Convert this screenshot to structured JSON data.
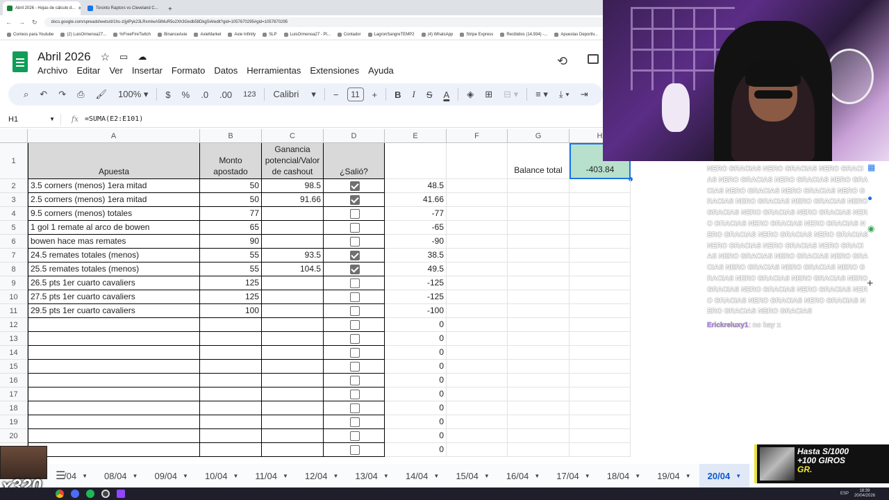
{
  "browser": {
    "tabs": [
      {
        "label": "Abril 2026 - Hojas de cálculo d...",
        "active": true
      },
      {
        "label": "Toronto Raptors vs Cleveland C...",
        "active": false
      }
    ],
    "new_tab": "+",
    "url": "docs.google.com/spreadsheets/d/1hs-zIjylPyk23LRxmIwA5lMuR5o2Xh3Gedb58DkgSi4/edit?gid=1057670295#gid=1057670295",
    "bookmarks": [
      "Correos para Youtube",
      "(2) LuisOrmenoa27...",
      "%FreeFireTwitch",
      "BinanceAxie",
      "AxieMarket",
      "Axie Infinity",
      "SLP",
      "LuisOrmenoa27 - Pl...",
      "Contador",
      "LagronSangreTEMP2",
      "(4) WhatsApp",
      "Stripe Express",
      "Recibidos (14,934) -...",
      "Apuestas Deportiv..."
    ]
  },
  "sheets": {
    "doc_title": "Abril 2026",
    "menu": [
      "Archivo",
      "Editar",
      "Ver",
      "Insertar",
      "Formato",
      "Datos",
      "Herramientas",
      "Extensiones",
      "Ayuda"
    ],
    "toolbar": {
      "zoom": "100%",
      "currency": "$",
      "percent": "%",
      "dec_less": ".0",
      "dec_more": ".00",
      "format_num": "123",
      "font": "Calibri",
      "font_size": "11",
      "minus": "−",
      "plus": "+",
      "bold": "B",
      "italic": "I",
      "strike": "S",
      "text_color": "A"
    },
    "name_box": "H1",
    "fx_label": "fx",
    "formula": "=SUMA(E2:E101)",
    "columns": [
      "A",
      "B",
      "C",
      "D",
      "E",
      "F",
      "G",
      "H"
    ],
    "header_row": {
      "a": "Apuesta",
      "b": "Monto apostado",
      "c": "Ganancia potencial/Valor de cashout",
      "d": "¿Salió?",
      "g": "Balance total",
      "h": "-403.84"
    },
    "rows": [
      {
        "n": "2",
        "a": "3.5 corners (menos) 1era mitad",
        "b": "50",
        "c": "98.5",
        "checked": true,
        "e": "48.5"
      },
      {
        "n": "3",
        "a": "2.5 corners (menos) 1era mitad",
        "b": "50",
        "c": "91.66",
        "checked": true,
        "e": "41.66"
      },
      {
        "n": "4",
        "a": "9.5 corners (menos) totales",
        "b": "77",
        "c": "",
        "checked": false,
        "e": "-77"
      },
      {
        "n": "5",
        "a": "1 gol 1 remate al arco de bowen",
        "b": "65",
        "c": "",
        "checked": false,
        "e": "-65"
      },
      {
        "n": "6",
        "a": "bowen hace mas remates",
        "b": "90",
        "c": "",
        "checked": false,
        "e": "-90"
      },
      {
        "n": "7",
        "a": "24.5 remates totales (menos)",
        "b": "55",
        "c": "93.5",
        "checked": true,
        "e": "38.5"
      },
      {
        "n": "8",
        "a": "25.5 remates totales (menos)",
        "b": "55",
        "c": "104.5",
        "checked": true,
        "e": "49.5"
      },
      {
        "n": "9",
        "a": "26.5 pts 1er cuarto cavaliers",
        "b": "125",
        "c": "",
        "checked": false,
        "e": "-125"
      },
      {
        "n": "10",
        "a": "27.5 pts 1er cuarto cavaliers",
        "b": "125",
        "c": "",
        "checked": false,
        "e": "-125"
      },
      {
        "n": "11",
        "a": "29.5 pts 1er cuarto cavaliers",
        "b": "100",
        "c": "",
        "checked": false,
        "e": "-100"
      },
      {
        "n": "12",
        "a": "",
        "b": "",
        "c": "",
        "checked": false,
        "e": "0"
      },
      {
        "n": "13",
        "a": "",
        "b": "",
        "c": "",
        "checked": false,
        "e": "0"
      },
      {
        "n": "14",
        "a": "",
        "b": "",
        "c": "",
        "checked": false,
        "e": "0"
      },
      {
        "n": "15",
        "a": "",
        "b": "",
        "c": "",
        "checked": false,
        "e": "0"
      },
      {
        "n": "16",
        "a": "",
        "b": "",
        "c": "",
        "checked": false,
        "e": "0"
      },
      {
        "n": "17",
        "a": "",
        "b": "",
        "c": "",
        "checked": false,
        "e": "0"
      },
      {
        "n": "18",
        "a": "",
        "b": "",
        "c": "",
        "checked": false,
        "e": "0"
      },
      {
        "n": "19",
        "a": "",
        "b": "",
        "c": "",
        "checked": false,
        "e": "0"
      },
      {
        "n": "20",
        "a": "",
        "b": "",
        "c": "",
        "checked": false,
        "e": "0"
      },
      {
        "n": "",
        "a": "",
        "b": "",
        "c": "",
        "checked": false,
        "e": "0"
      }
    ],
    "sheet_tabs": [
      "/04",
      "08/04",
      "09/04",
      "10/04",
      "11/04",
      "12/04",
      "13/04",
      "14/04",
      "15/04",
      "16/04",
      "17/04",
      "18/04",
      "19/04",
      "20/04"
    ],
    "active_sheet": "20/04"
  },
  "chat": {
    "spam": "NERO GRACIAS NERO GRACIAS NERO GRACIAS NERO GRACIAS NERO GRACIAS NERO GRACIAS NERO GRACIAS NERO GRACIAS NERO GRACIAS NERO GRACIAS NERO GRACIAS NERO GRACIAS NERO GRACIAS NERO GRACIAS NERO GRACIAS NERO GRACIAS NERO GRACIAS NERO GRACIAS NERO GRACIAS NERO GRACIAS NERO GRACIAS NERO GRACIAS NERO GRACIAS NERO GRACIAS NERO GRACIAS NERO GRACIAS NERO GRACIAS NERO GRACIAS NERO GRACIAS NERO GRACIAS NERO GRACIAS NERO GRACIAS NERO GRACIAS NERO GRACIAS NERO GRACIAS NERO GRACIAS NERO GRACIAS NERO GRACIAS NERO GRACIAS",
    "user": "Erickreluxy1",
    "message": ": no hay x"
  },
  "overlay": {
    "badge": "x320",
    "banner_line1": "Hasta S/1000",
    "banner_line2": "+100 GIROS",
    "banner_line3": "GR."
  },
  "taskbar": {
    "lang": "ESP",
    "time": "18:39",
    "date": "20/04/2026"
  }
}
